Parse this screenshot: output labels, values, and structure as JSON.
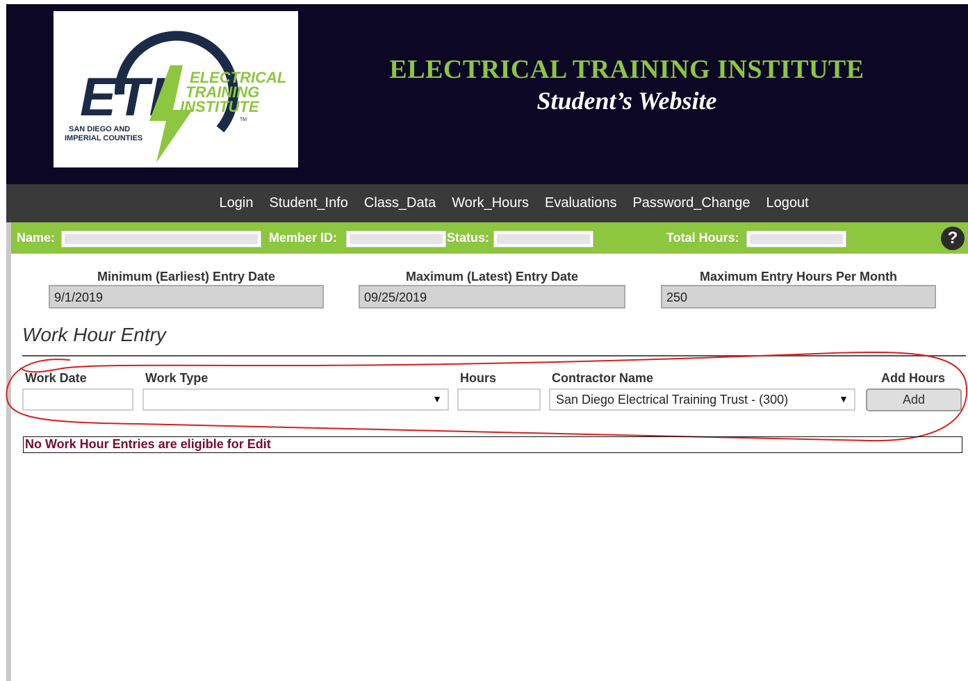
{
  "header": {
    "logo": {
      "monogram": "ETI",
      "lines": [
        "ELECTRICAL",
        "TRAINING",
        "INSTITUTE"
      ],
      "trademark": "TM",
      "region_lines": [
        "SAN DIEGO AND",
        "IMPERIAL COUNTIES"
      ]
    },
    "title": "ELECTRICAL TRAINING INSTITUTE",
    "subtitle": "Student’s Website"
  },
  "nav": {
    "items": [
      "Login",
      "Student_Info",
      "Class_Data",
      "Work_Hours",
      "Evaluations",
      "Password_Change",
      "Logout"
    ]
  },
  "info_bar": {
    "name_label": "Name:",
    "member_id_label": "Member ID:",
    "status_label": "Status:",
    "total_hours_label": "Total Hours:",
    "help_icon": "?"
  },
  "limits": {
    "min_label": "Minimum (Earliest) Entry Date",
    "min_value": "9/1/2019",
    "max_label": "Maximum (Latest) Entry Date",
    "max_value": "09/25/2019",
    "hours_label": "Maximum Entry Hours Per Month",
    "hours_value": "250"
  },
  "section": {
    "title": "Work Hour Entry"
  },
  "form": {
    "work_date_label": "Work Date",
    "work_date_value": "",
    "work_type_label": "Work Type",
    "work_type_value": "",
    "hours_label": "Hours",
    "hours_value": "",
    "contractor_label": "Contractor Name",
    "contractor_value": "San Diego Electrical Training Trust - (300)",
    "add_hours_label": "Add Hours",
    "add_button": "Add"
  },
  "message": "No Work Hour Entries are eligible for Edit",
  "colors": {
    "header_bg": "#0b0724",
    "accent_green": "#8dc63f",
    "nav_bg": "#3a3a3a",
    "logo_navy": "#1b2b47",
    "annotation_red": "#d81e1e",
    "message_text": "#7a0c2e"
  }
}
